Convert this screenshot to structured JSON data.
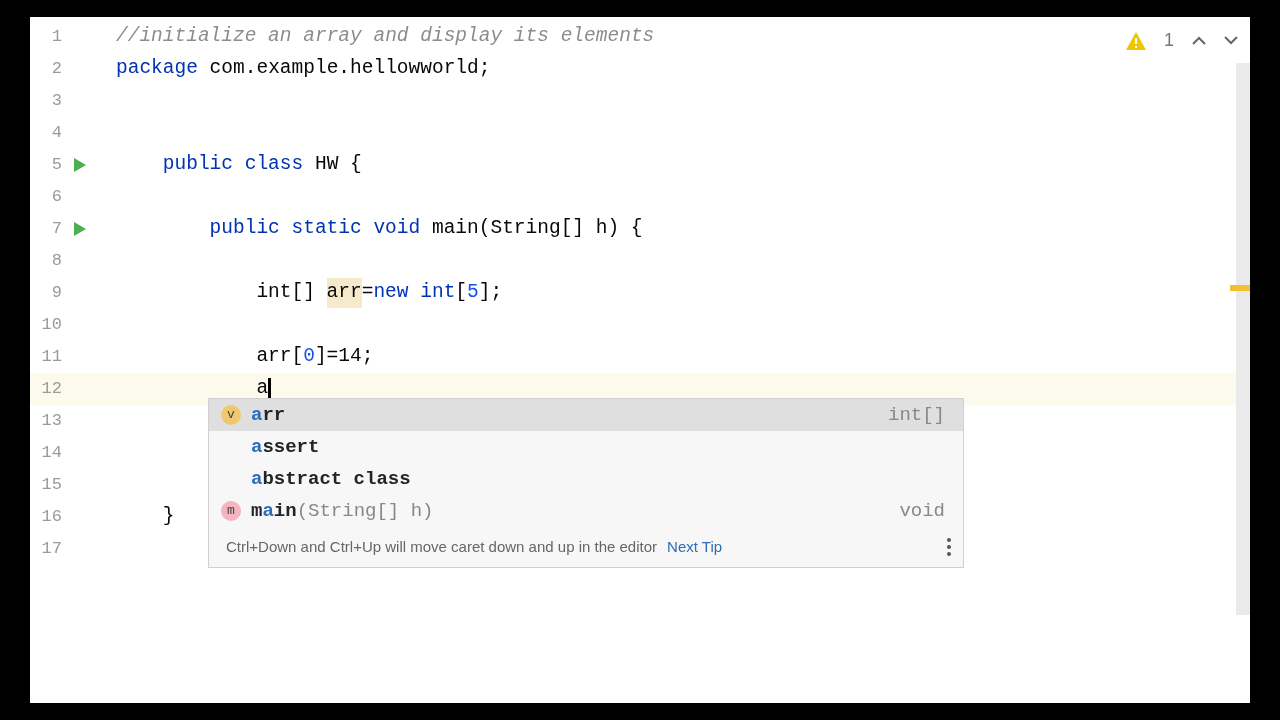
{
  "editor": {
    "lines": [
      {
        "number": "1",
        "run": false,
        "current": false,
        "tokens": [
          {
            "kind": "comment",
            "text": "//initialize an array and display its elements"
          }
        ]
      },
      {
        "number": "2",
        "run": false,
        "current": false,
        "tokens": [
          {
            "kind": "keyword",
            "text": "package"
          },
          {
            "kind": "plain",
            "text": " com.example.hellowworld;"
          }
        ]
      },
      {
        "number": "3",
        "run": false,
        "current": false
      },
      {
        "number": "4",
        "run": false,
        "current": false,
        "children": [
          {
            "number": "5",
            "run": true,
            "current": false,
            "tokens": [
              {
                "kind": "keyword",
                "text": "public class"
              },
              {
                "kind": "plain",
                "text": " HW {"
              }
            ],
            "children": [
              {
                "number": "6",
                "run": false,
                "current": false
              },
              {
                "number": "7",
                "run": true,
                "current": false,
                "tokens": [
                  {
                    "kind": "keyword",
                    "text": "public static void"
                  },
                  {
                    "kind": "plain",
                    "text": " main(String[] h) {"
                  }
                ],
                "children": [
                  {
                    "number": "8",
                    "run": false,
                    "current": false
                  },
                  {
                    "number": "9",
                    "run": false,
                    "current": false,
                    "tokens": [
                      {
                        "kind": "plain",
                        "text": "int[] "
                      },
                      {
                        "kind": "usage",
                        "text": "arr"
                      },
                      {
                        "kind": "plain",
                        "text": "="
                      },
                      {
                        "kind": "keyword",
                        "text": "new int"
                      },
                      {
                        "kind": "plain",
                        "text": "["
                      },
                      {
                        "kind": "number",
                        "text": "5"
                      },
                      {
                        "kind": "plain",
                        "text": "];"
                      }
                    ]
                  },
                  {
                    "number": "10",
                    "run": false,
                    "current": false
                  },
                  {
                    "number": "11",
                    "run": false,
                    "current": false,
                    "tokens": [
                      {
                        "kind": "plain",
                        "text": "arr["
                      },
                      {
                        "kind": "number",
                        "text": "0"
                      },
                      {
                        "kind": "plain",
                        "text": "]=14;"
                      }
                    ]
                  },
                  {
                    "number": "12",
                    "run": false,
                    "current": true,
                    "tokens": [
                      {
                        "kind": "plain",
                        "text": "a"
                      }
                    ]
                  },
                  {
                    "number": "13",
                    "run": false,
                    "current": false
                  },
                  {
                    "number": "14",
                    "run": false,
                    "current": false
                  },
                  {
                    "number": "15",
                    "run": false,
                    "current": false
                  }
                ]
              }
            ]
          },
          {
            "number": "16",
            "run": false,
            "current": false,
            "tokens": [
              {
                "kind": "plain",
                "text": "}"
              }
            ]
          }
        ]
      },
      {
        "number": "17",
        "run": false,
        "current": false
      }
    ]
  },
  "inspection": {
    "count": "1"
  },
  "completion": {
    "items": [
      {
        "icon": "v",
        "color": "#f0c870",
        "selected": true,
        "parts": [
          {
            "text": "a",
            "matched": true
          },
          {
            "text": "rr",
            "matched": false
          }
        ],
        "type": "int[]"
      },
      {
        "selected": false,
        "parts": [
          {
            "text": "a",
            "matched": true
          },
          {
            "text": "ssert",
            "matched": false
          }
        ]
      },
      {
        "selected": false,
        "parts": [
          {
            "text": "a",
            "matched": true
          },
          {
            "text": "bstract class",
            "matched": false
          }
        ]
      },
      {
        "icon": "m",
        "color": "#f4b5c0",
        "selected": false,
        "parts": [
          {
            "text": "m",
            "matched": false
          },
          {
            "text": "a",
            "matched": true
          },
          {
            "text": "in",
            "matched": false
          }
        ],
        "params": "(String[] h)",
        "type": "void"
      }
    ],
    "tip": "Ctrl+Down and Ctrl+Up will move caret down and up in the editor",
    "tip_link": "Next Tip"
  }
}
